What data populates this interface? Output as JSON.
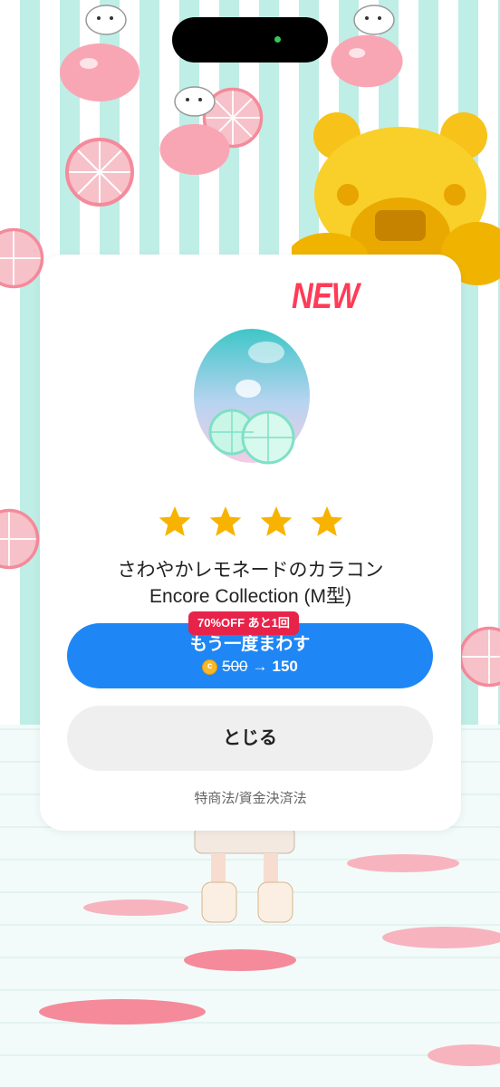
{
  "status_bar": {
    "indicator_color": "#34c759"
  },
  "modal": {
    "new_badge": "NEW",
    "item_icon": "lemonade-contact-lens-icon",
    "rating_stars": 4,
    "title_line1": "さわやかレモネードのカラコン",
    "title_line2": "Encore Collection (M型)",
    "spin_button": {
      "discount_badge": "70%OFF あと1回",
      "label": "もう一度まわす",
      "coin_icon": "coin-icon",
      "old_price": "500",
      "arrow": "→",
      "new_price": "150",
      "color": "#1f86f5"
    },
    "close_button": "とじる",
    "legal_link": "特商法/資金決済法"
  },
  "colors": {
    "accent": "#1f86f5",
    "new_badge": "#ff3b57",
    "discount_badge": "#e8234a",
    "star": "#f7b300"
  }
}
